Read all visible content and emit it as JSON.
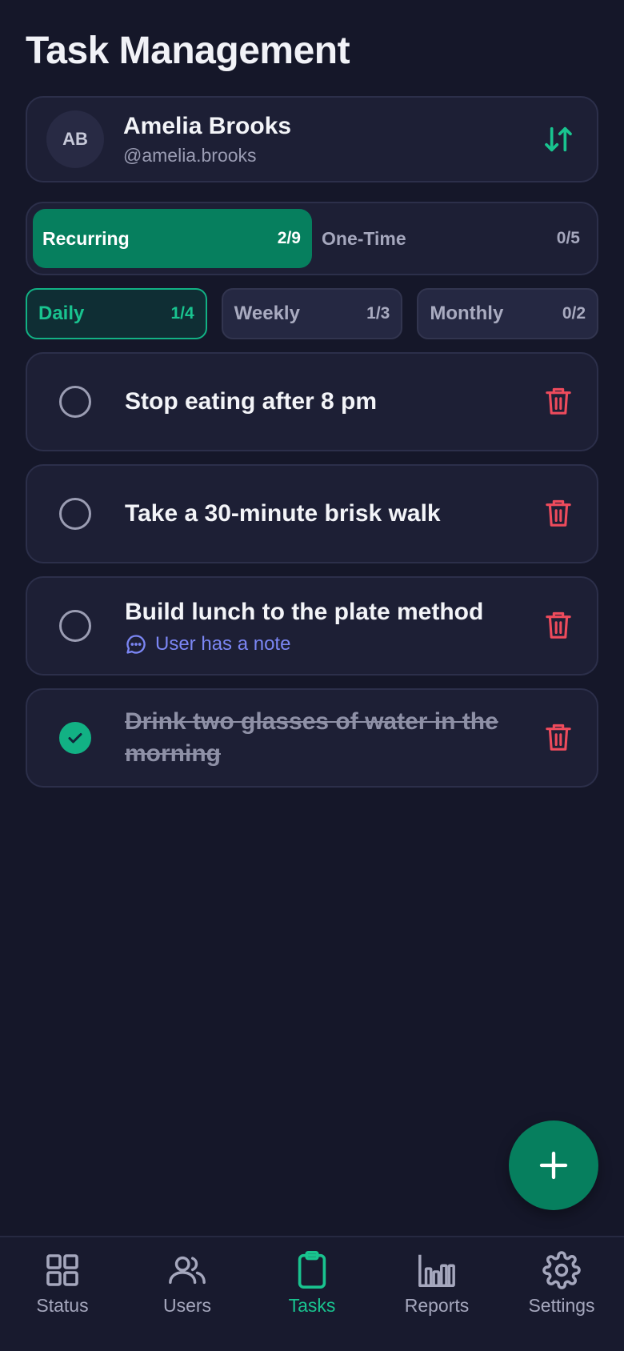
{
  "page": {
    "title": "Task Management"
  },
  "user": {
    "initials": "AB",
    "name": "Amelia Brooks",
    "handle": "@amelia.brooks"
  },
  "primary_tabs": [
    {
      "label": "Recurring",
      "count": "2/9",
      "active": true
    },
    {
      "label": "One-Time",
      "count": "0/5",
      "active": false
    }
  ],
  "sub_tabs": [
    {
      "label": "Daily",
      "count": "1/4",
      "active": true
    },
    {
      "label": "Weekly",
      "count": "1/3",
      "active": false
    },
    {
      "label": "Monthly",
      "count": "0/2",
      "active": false
    }
  ],
  "tasks": [
    {
      "title": "Stop eating after 8 pm",
      "done": false,
      "note": ""
    },
    {
      "title": "Take a 30-minute brisk walk",
      "done": false,
      "note": ""
    },
    {
      "title": "Build lunch to the plate method",
      "done": false,
      "note": "User has a note"
    },
    {
      "title": "Drink two glasses of water in the morning",
      "done": true,
      "note": ""
    }
  ],
  "nav": [
    {
      "label": "Status",
      "icon": "grid-icon",
      "active": false
    },
    {
      "label": "Users",
      "icon": "users-icon",
      "active": false
    },
    {
      "label": "Tasks",
      "icon": "clipboard-icon",
      "active": true
    },
    {
      "label": "Reports",
      "icon": "bar-chart-icon",
      "active": false
    },
    {
      "label": "Settings",
      "icon": "gear-icon",
      "active": false
    }
  ],
  "colors": {
    "background": "#151729",
    "card": "#1d1f35",
    "accent": "#067f5e",
    "accent_bright": "#19c38f",
    "danger": "#ee4b5c",
    "note": "#7b86f4"
  }
}
